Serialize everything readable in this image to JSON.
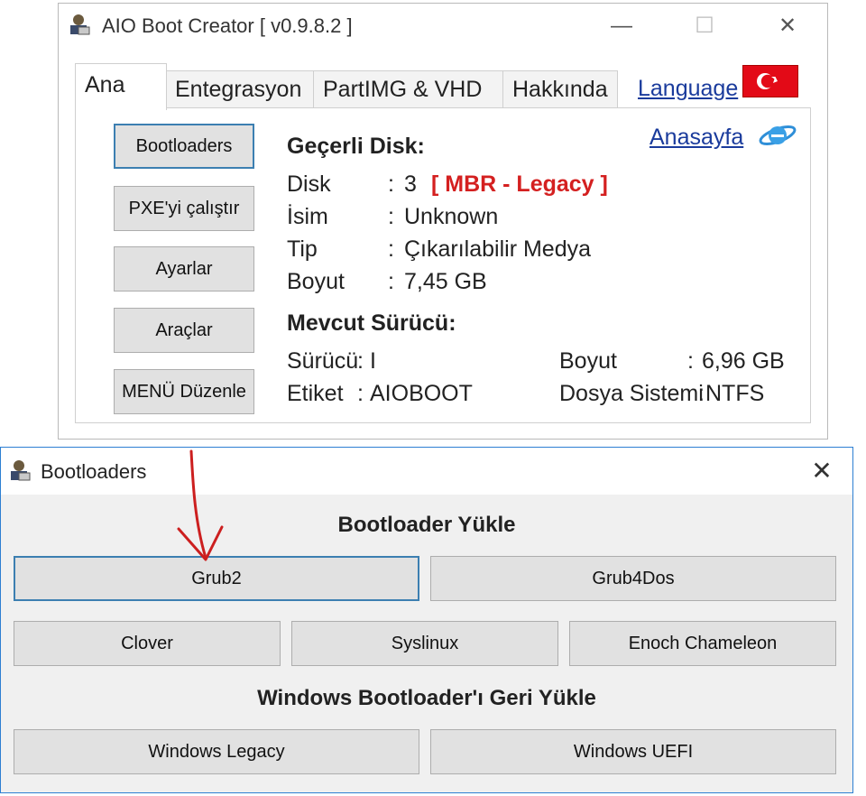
{
  "main_window": {
    "title": "AIO Boot Creator [ v0.9.8.2 ]",
    "controls": {
      "minimize": "—",
      "maximize": "☐",
      "close": "✕"
    },
    "tabs": [
      {
        "label": "Ana",
        "active": true
      },
      {
        "label": "Entegrasyon",
        "active": false
      },
      {
        "label": "PartIMG & VHD",
        "active": false
      },
      {
        "label": "Hakkında",
        "active": false
      }
    ],
    "language_link": "Language",
    "homepage_link": "Anasayfa",
    "side_buttons": [
      {
        "label": "Bootloaders",
        "focused": true
      },
      {
        "label": "PXE'yi çalıştır",
        "focused": false
      },
      {
        "label": "Ayarlar",
        "focused": false
      },
      {
        "label": "Araçlar",
        "focused": false
      },
      {
        "label": "MENÜ Düzenle",
        "focused": false
      }
    ],
    "current_disk": {
      "heading": "Geçerli Disk:",
      "rows": [
        {
          "key": "Disk",
          "sep": ":",
          "value": "3",
          "extra": "[ MBR - Legacy ]"
        },
        {
          "key": "İsim",
          "sep": ":",
          "value": "Unknown"
        },
        {
          "key": "Tip",
          "sep": ":",
          "value": "Çıkarılabilir Medya"
        },
        {
          "key": "Boyut",
          "sep": ":",
          "value": "7,45 GB"
        }
      ]
    },
    "current_drive": {
      "heading": "Mevcut Sürücü:",
      "left": [
        {
          "key": "Sürücü",
          "sep": ":",
          "value": "I"
        },
        {
          "key": "Etiket",
          "sep": ":",
          "value": "AIOBOOT"
        }
      ],
      "right": [
        {
          "key": "Boyut",
          "sep": ":",
          "value": "6,96 GB"
        },
        {
          "key": "Dosya Sistemi",
          "sep": ":",
          "value": "NTFS"
        }
      ]
    }
  },
  "dialog": {
    "title": "Bootloaders",
    "close": "✕",
    "section1": "Bootloader Yükle",
    "section2": "Windows Bootloader'ı Geri Yükle",
    "buttons": {
      "grub2": "Grub2",
      "grub4dos": "Grub4Dos",
      "clover": "Clover",
      "syslinux": "Syslinux",
      "enoch": "Enoch Chameleon",
      "win_legacy": "Windows Legacy",
      "win_uefi": "Windows UEFI"
    }
  },
  "colors": {
    "accent_focus": "#3c7fb1",
    "warning_red": "#d42020",
    "flag_red": "#e30a17",
    "link_blue": "#1a3b9c",
    "annotation_arrow": "#cc1f1f"
  }
}
